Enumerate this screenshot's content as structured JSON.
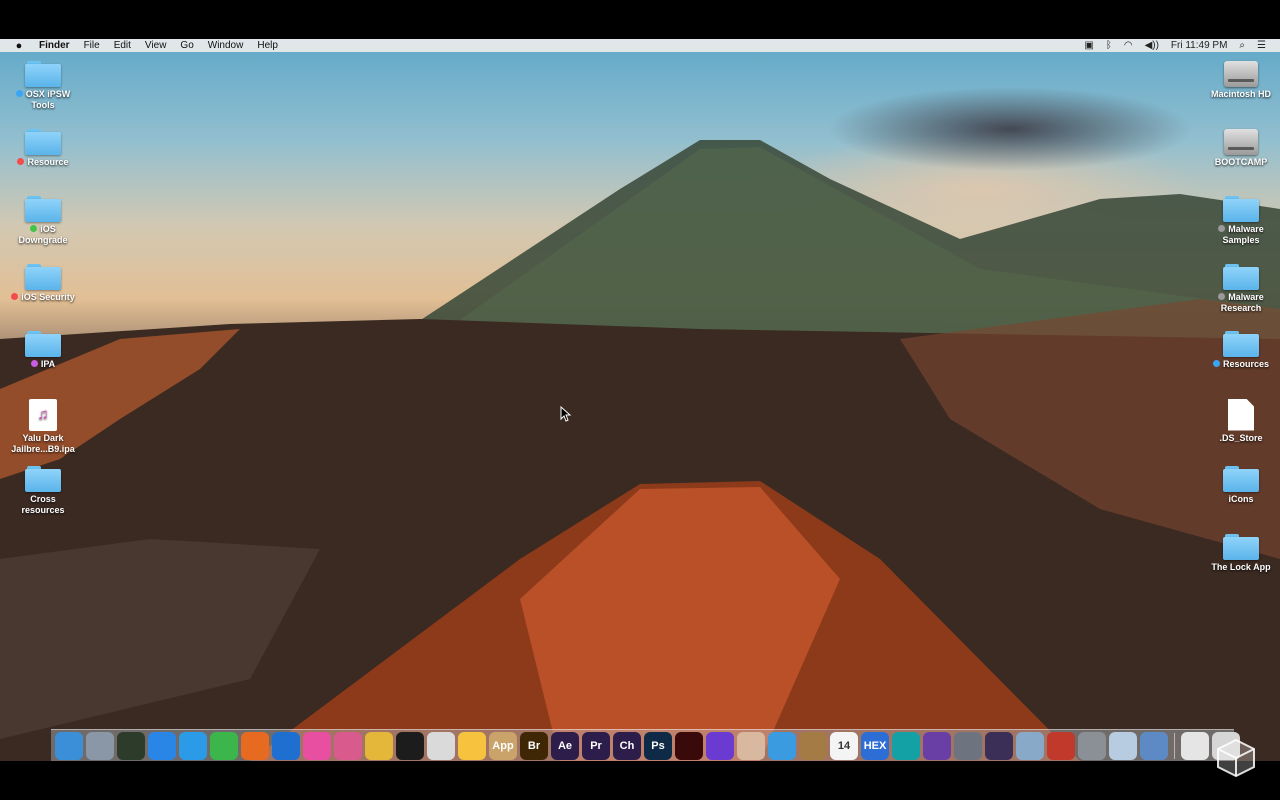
{
  "menubar": {
    "apple_icon": "apple-icon",
    "app_name": "Finder",
    "menus": [
      "File",
      "Edit",
      "View",
      "Go",
      "Window",
      "Help"
    ],
    "clock": "Fri 11:49 PM",
    "status_icons": [
      "screen-record-icon",
      "bluetooth-icon",
      "wifi-icon",
      "volume-icon",
      "search-icon",
      "list-icon"
    ]
  },
  "desktop_left": [
    {
      "label": "OSX iPSW Tools",
      "line1": "OSX iPSW",
      "line2": "Tools",
      "kind": "folder",
      "tag": "#3aa5f5"
    },
    {
      "label": "Resource",
      "line1": "Resource",
      "line2": "",
      "kind": "folder",
      "tag": "#f44b4b"
    },
    {
      "label": "iOS Downgrade",
      "line1": "iOS",
      "line2": "Downgrade",
      "kind": "folder",
      "tag": "#45c44b"
    },
    {
      "label": "iOS Security",
      "line1": "iOS Security",
      "line2": "",
      "kind": "folder",
      "tag": "#f44b4b"
    },
    {
      "label": "IPA",
      "line1": "IPA",
      "line2": "",
      "kind": "folder",
      "tag": "#c95de0"
    },
    {
      "label": "Yalu Dark Jailbre...B9.ipa",
      "line1": "Yalu Dark",
      "line2": "Jailbre...B9.ipa",
      "kind": "ipa",
      "tag": ""
    },
    {
      "label": "Cross resources",
      "line1": "Cross",
      "line2": "resources",
      "kind": "folder",
      "tag": ""
    }
  ],
  "desktop_right": [
    {
      "label": "Macintosh HD",
      "line1": "Macintosh HD",
      "line2": "",
      "kind": "disk",
      "tag": ""
    },
    {
      "label": "BOOTCAMP",
      "line1": "BOOTCAMP",
      "line2": "",
      "kind": "disk",
      "tag": ""
    },
    {
      "label": "Malware Samples",
      "line1": "Malware",
      "line2": "Samples",
      "kind": "folder",
      "tag": "#9a9a9a"
    },
    {
      "label": "Malware Research",
      "line1": "Malware",
      "line2": "Research",
      "kind": "folder",
      "tag": "#9a9a9a"
    },
    {
      "label": "Resources",
      "line1": "Resources",
      "line2": "",
      "kind": "folder",
      "tag": "#3aa5f5"
    },
    {
      "label": ".DS_Store",
      "line1": ".DS_Store",
      "line2": "",
      "kind": "doc",
      "tag": ""
    },
    {
      "label": "iCons",
      "line1": "iCons",
      "line2": "",
      "kind": "folder",
      "tag": ""
    },
    {
      "label": "The Lock App",
      "line1": "The Lock App",
      "line2": "",
      "kind": "folder",
      "tag": ""
    }
  ],
  "dock": {
    "apps": [
      {
        "name": "finder-icon",
        "text": "",
        "color": "#3b8fd8"
      },
      {
        "name": "launchpad-icon",
        "text": "",
        "color": "#8a97a6"
      },
      {
        "name": "mission-control-icon",
        "text": "",
        "color": "#2d3b2b"
      },
      {
        "name": "app-store-icon",
        "text": "",
        "color": "#2a86e6"
      },
      {
        "name": "safari-icon",
        "text": "",
        "color": "#2b9be8"
      },
      {
        "name": "facetime-icon",
        "text": "",
        "color": "#3cb54a"
      },
      {
        "name": "firefox-icon",
        "text": "",
        "color": "#e66a1f"
      },
      {
        "name": "teamviewer-icon",
        "text": "",
        "color": "#1f6fd1"
      },
      {
        "name": "itunes-icon",
        "text": "",
        "color": "#e84fa0"
      },
      {
        "name": "ibooks-icon",
        "text": "",
        "color": "#d95a8d"
      },
      {
        "name": "chrome-icon",
        "text": "",
        "color": "#e4b63a"
      },
      {
        "name": "terminal-icon",
        "text": "",
        "color": "#1c1c1c"
      },
      {
        "name": "archive-utility-icon",
        "text": "",
        "color": "#dadada"
      },
      {
        "name": "sketch-icon",
        "text": "",
        "color": "#f7c23d"
      },
      {
        "name": "app-tool-icon",
        "text": "App",
        "color": "#c9a36a"
      },
      {
        "name": "bridge-icon",
        "text": "Br",
        "color": "#3f2705"
      },
      {
        "name": "after-effects-icon",
        "text": "Ae",
        "color": "#2c1d4a"
      },
      {
        "name": "premiere-icon",
        "text": "Pr",
        "color": "#2c1d4a"
      },
      {
        "name": "character-animator-icon",
        "text": "Ch",
        "color": "#2c1d4a"
      },
      {
        "name": "photoshop-icon",
        "text": "Ps",
        "color": "#0e2a47"
      },
      {
        "name": "acrobat-icon",
        "text": "",
        "color": "#3a0a0a"
      },
      {
        "name": "imovie-icon",
        "text": "",
        "color": "#6b3ad1"
      },
      {
        "name": "portrait-app-icon",
        "text": "",
        "color": "#d8b9a0"
      },
      {
        "name": "xcode-icon",
        "text": "",
        "color": "#3a9be0"
      },
      {
        "name": "notebook-icon",
        "text": "",
        "color": "#a57b45"
      },
      {
        "name": "calendar-icon",
        "text": "14",
        "color": "#f4f4f4"
      },
      {
        "name": "hex-fiend-icon",
        "text": "HEX",
        "color": "#2c6dd6"
      },
      {
        "name": "arduino-icon",
        "text": "",
        "color": "#14a1a6"
      },
      {
        "name": "github-icon",
        "text": "",
        "color": "#6a3fa5"
      },
      {
        "name": "utility-icon",
        "text": "",
        "color": "#6d7480"
      },
      {
        "name": "wizard-icon",
        "text": "",
        "color": "#3b2f57"
      },
      {
        "name": "preview-icon",
        "text": "",
        "color": "#89a9c8"
      },
      {
        "name": "photo-booth-icon",
        "text": "",
        "color": "#c0392b"
      },
      {
        "name": "system-preferences-icon",
        "text": "",
        "color": "#8b8f96"
      },
      {
        "name": "preview-images-icon",
        "text": "",
        "color": "#b7cce0"
      },
      {
        "name": "movie-maker-icon",
        "text": "",
        "color": "#5d89c4"
      },
      {
        "name": "downloads-stack-icon",
        "text": "",
        "color": "#e5e5e5"
      },
      {
        "name": "trash-icon",
        "text": "",
        "color": "#d6d6d6"
      }
    ]
  }
}
